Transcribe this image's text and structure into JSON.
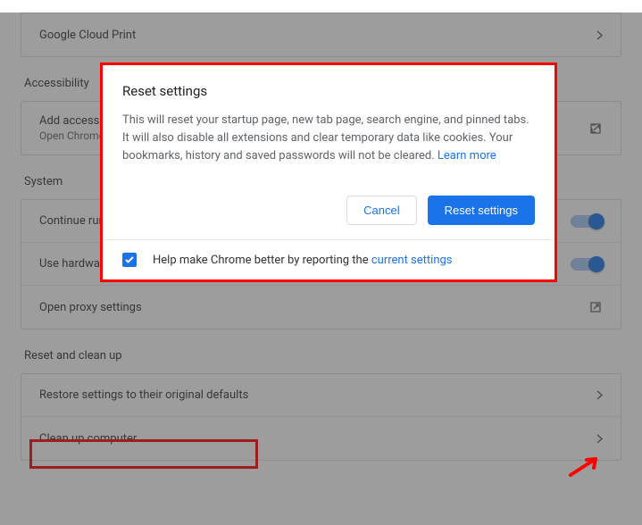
{
  "rows": {
    "cloud_print": "Google Cloud Print",
    "accessibility_title": "Accessibility",
    "accessibility_label": "Add accessibility features",
    "accessibility_sub": "Open Chrome Web Store",
    "system_title": "System",
    "continue_running": "Continue running background apps when Google Chrome is closed",
    "hw_accel": "Use hardware acceleration when available",
    "proxy": "Open proxy settings",
    "reset_title": "Reset and clean up",
    "restore_defaults": "Restore settings to their original defaults",
    "clean_up": "Clean up computer"
  },
  "dialog": {
    "title": "Reset settings",
    "body": "This will reset your startup page, new tab page, search engine, and pinned tabs. It will also disable all extensions and clear temporary data like cookies. Your bookmarks, history and saved passwords will not be cleared. ",
    "learn_more": "Learn more",
    "cancel": "Cancel",
    "confirm": "Reset settings",
    "footer_prefix": "Help make Chrome better by reporting the ",
    "footer_link": "current settings"
  }
}
